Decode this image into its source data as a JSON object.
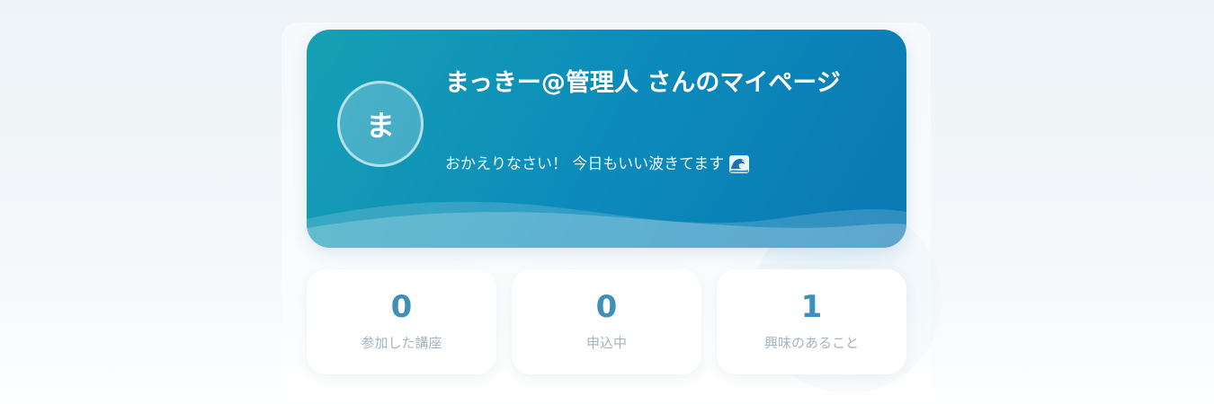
{
  "profile": {
    "avatar_initial": "ま",
    "title": "まっきー@管理人 さんのマイページ",
    "greeting": "おかえりなさい！ 今日もいい波きてます",
    "greeting_icon": "wave-icon"
  },
  "stats": [
    {
      "value": "0",
      "label": "参加した講座"
    },
    {
      "value": "0",
      "label": "申込中"
    },
    {
      "value": "1",
      "label": "興味のあること"
    }
  ],
  "colors": {
    "hero_start": "#17a0b4",
    "hero_end": "#0a78b3",
    "stat_value": "#3e90b8",
    "stat_label": "#a4b4c1"
  }
}
